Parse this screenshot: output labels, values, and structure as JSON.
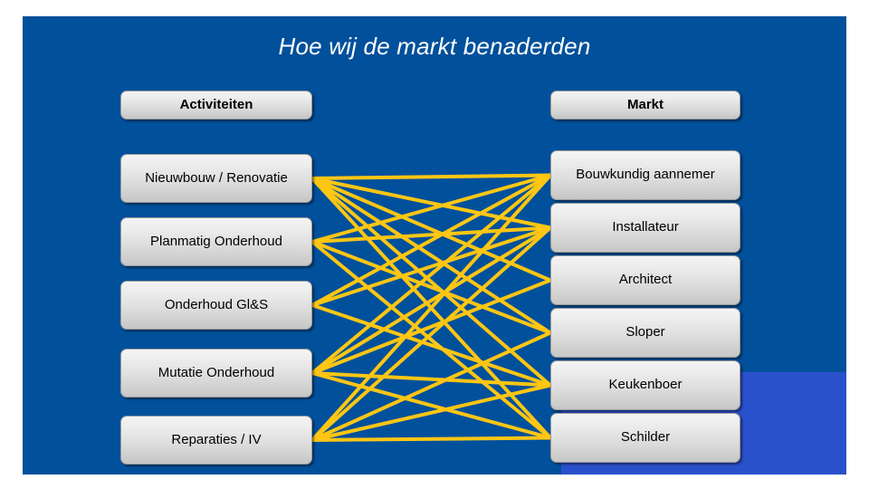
{
  "slide": {
    "title": "Hoe wij de markt benaderden",
    "background_color": "#00509B",
    "accent_rect_color": "#2A51CC",
    "connector_color": "#FFC613",
    "box_text_color": "#000000",
    "title_color": "#FFFFFF"
  },
  "left_column": {
    "header": "Activiteiten",
    "items": [
      {
        "label": "Nieuwbouw / Renovatie"
      },
      {
        "label": "Planmatig Onderhoud"
      },
      {
        "label": "Onderhoud Gl&S"
      },
      {
        "label": "Mutatie Onderhoud"
      },
      {
        "label": "Reparaties / IV"
      }
    ]
  },
  "right_column": {
    "header": "Markt",
    "items": [
      {
        "label": "Bouwkundig aannemer"
      },
      {
        "label": "Installateur"
      },
      {
        "label": "Architect"
      },
      {
        "label": "Sloper"
      },
      {
        "label": "Keukenboer"
      },
      {
        "label": "Schilder"
      }
    ]
  },
  "chart_data": {
    "type": "diagram",
    "subtype": "bipartite-network",
    "title": "Hoe wij de markt benaderden",
    "left_nodes": [
      "Nieuwbouw / Renovatie",
      "Planmatig Onderhoud",
      "Onderhoud Gl&S",
      "Mutatie Onderhoud",
      "Reparaties / IV"
    ],
    "right_nodes": [
      "Bouwkundig aannemer",
      "Installateur",
      "Architect",
      "Sloper",
      "Keukenboer",
      "Schilder"
    ],
    "edges": [
      [
        0,
        0
      ],
      [
        0,
        1
      ],
      [
        0,
        2
      ],
      [
        0,
        3
      ],
      [
        0,
        4
      ],
      [
        0,
        5
      ],
      [
        1,
        0
      ],
      [
        1,
        1
      ],
      [
        1,
        3
      ],
      [
        1,
        5
      ],
      [
        2,
        0
      ],
      [
        2,
        1
      ],
      [
        2,
        4
      ],
      [
        3,
        0
      ],
      [
        3,
        1
      ],
      [
        3,
        2
      ],
      [
        3,
        4
      ],
      [
        3,
        5
      ],
      [
        4,
        0
      ],
      [
        4,
        1
      ],
      [
        4,
        3
      ],
      [
        4,
        4
      ],
      [
        4,
        5
      ]
    ],
    "edge_color": "#FFC613",
    "edge_count": 23,
    "legend": [],
    "notes": "Every activity on the left is linked by yellow lines to the market parties on the right."
  }
}
